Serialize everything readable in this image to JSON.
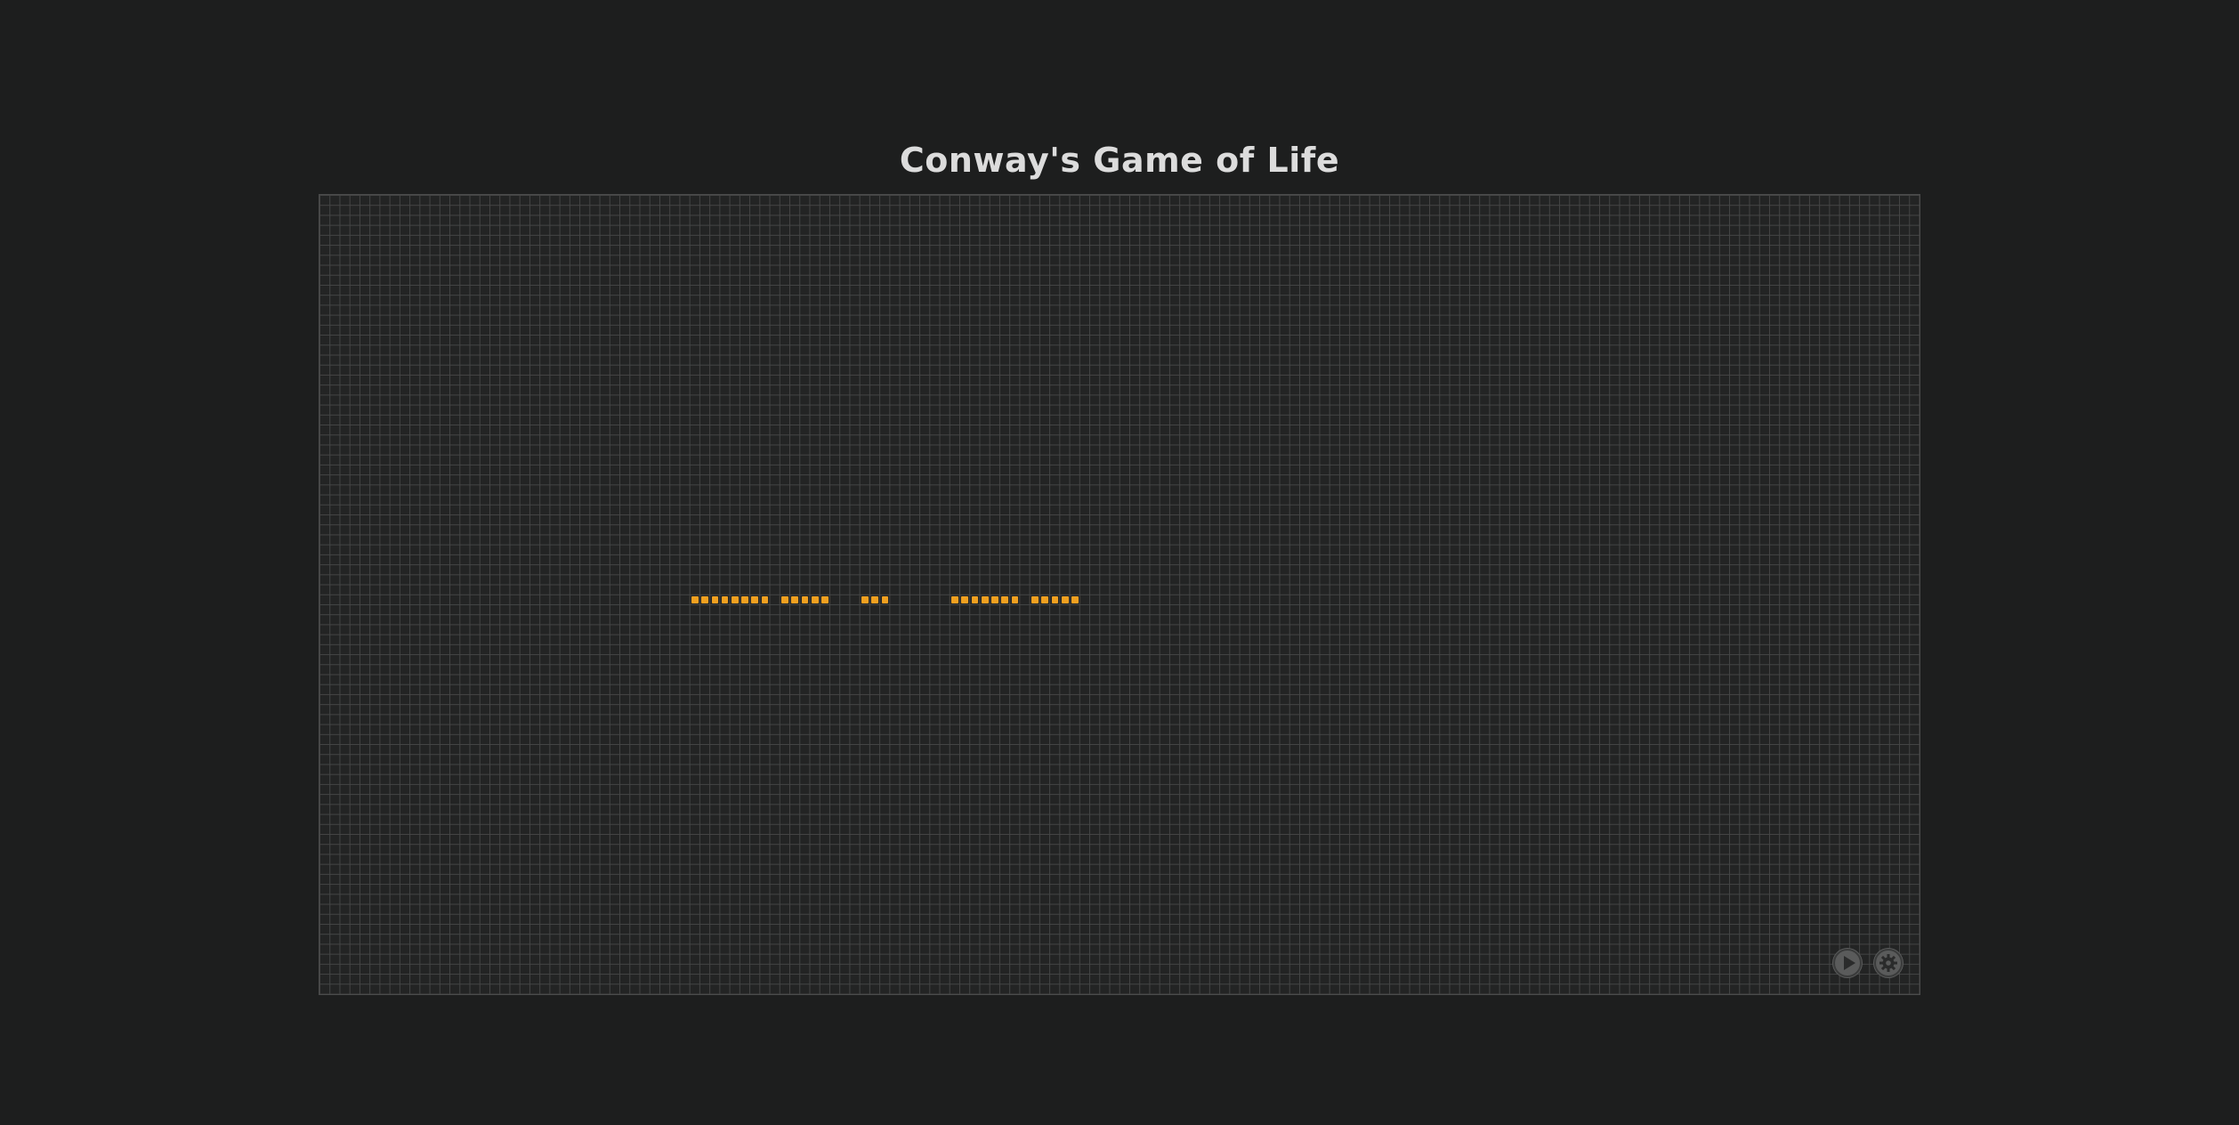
{
  "page": {
    "title": "Conway's Game of Life"
  },
  "board": {
    "columns": 160,
    "rows": 80,
    "live_color": "#f0a020",
    "grid_color": "#444545",
    "background_color": "#232424",
    "live_cells": [
      [
        37,
        40
      ],
      [
        38,
        40
      ],
      [
        39,
        40
      ],
      [
        40,
        40
      ],
      [
        41,
        40
      ],
      [
        42,
        40
      ],
      [
        43,
        40
      ],
      [
        44,
        40
      ],
      [
        46,
        40
      ],
      [
        47,
        40
      ],
      [
        48,
        40
      ],
      [
        49,
        40
      ],
      [
        50,
        40
      ],
      [
        54,
        40
      ],
      [
        55,
        40
      ],
      [
        56,
        40
      ],
      [
        63,
        40
      ],
      [
        64,
        40
      ],
      [
        65,
        40
      ],
      [
        66,
        40
      ],
      [
        67,
        40
      ],
      [
        68,
        40
      ],
      [
        69,
        40
      ],
      [
        71,
        40
      ],
      [
        72,
        40
      ],
      [
        73,
        40
      ],
      [
        74,
        40
      ],
      [
        75,
        40
      ]
    ]
  },
  "controls": {
    "play": {
      "icon": "play-icon"
    },
    "settings": {
      "icon": "gear-icon"
    },
    "button_color": "#5a5b5b"
  }
}
